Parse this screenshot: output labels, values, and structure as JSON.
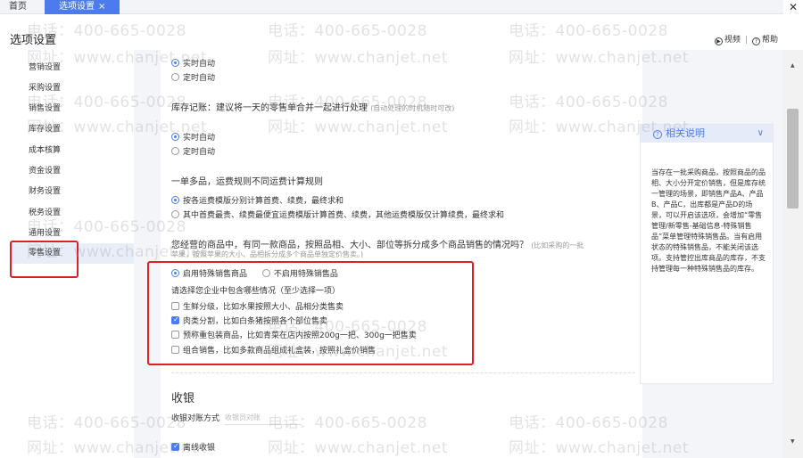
{
  "tabs": {
    "home": "首页",
    "active": "选项设置",
    "active_close": "×",
    "window_close": "✕"
  },
  "header": {
    "title": "选项设置",
    "video": "视频",
    "video_icon": "▶",
    "help": "帮助",
    "help_icon": "?",
    "separator": "|"
  },
  "sidebar": {
    "items": [
      "营销设置",
      "采购设置",
      "销售设置",
      "库存设置",
      "成本核算",
      "资金设置",
      "财务设置",
      "税务设置",
      "通用设置",
      "零售设置"
    ],
    "active_index": 9
  },
  "content": {
    "realtime_auto_1": "实时自动",
    "scheduled_auto_1": "定时自动",
    "stock_record_title": "库存记账：建议将一天的零售单合并一起进行处理",
    "stock_record_hint": "(自动处理的时机随时可改)",
    "realtime_auto_2": "实时自动",
    "scheduled_auto_2": "定时自动",
    "shipping_title": "一单多品，运费规则不同运费计算规则",
    "shipping_opt1": "按各运费模版分别计算首费、续费，最终求和",
    "shipping_opt2": "其中首费最贵、续费最便宜运费模版计算首费、续费，其他运费模版仅计算续费，最终求和",
    "split_title": "您经营的商品中，有同一款商品，按照品相、大小、部位等拆分成多个商品销售的情况吗？",
    "split_hint_1": "(比如采购的一批",
    "split_hint_2": "苹果，按照苹果的大小、品相拆分成多个商品单独定价售卖。)",
    "enable_special": "启用特殊销售商品",
    "disable_special": "不启用特殊销售品",
    "select_prompt": "请选择您企业中包含哪些情况（至少选择一项）",
    "options": [
      {
        "label": "生鲜分级，比如水果按照大小、品相分类售卖",
        "checked": false
      },
      {
        "label": "肉类分割，比如白条猪按照各个部位售卖",
        "checked": true
      },
      {
        "label": "预称重包装商品，比如青菜在店内按照200g一把、300g一把售卖",
        "checked": false
      },
      {
        "label": "组合销售，比如多款商品组成礼盒装，按照礼盒价销售",
        "checked": false
      }
    ],
    "checkout_title": "收银",
    "checkout_method_label": "收银对账方式",
    "checkout_method_value": "收银员对账",
    "offline_checkout": "离线收银"
  },
  "help_panel": {
    "title": "相关说明",
    "icon": "?",
    "chevron": "∨",
    "text": "当存在一批采购商品，按照商品的品相、大小分开定价销售，但是库存统一管理的场景，即销售产品A、产品B、产品C，出库都是产品D的场景，可以开启该选项，会增加“零售管理/新零售-基础信息-特殊销售品”菜单管理特殊销售品。当有启用状态的特殊销售品，不能关闭该选项。支持管控出库商品的库存，不支持管理每一种特殊销售品的库存。"
  },
  "watermark": {
    "phone": "电话：400-665-0028",
    "site": "网址：www.chanjet.net"
  },
  "colors": {
    "accent": "#4b7bec",
    "highlight_border": "#e02020"
  }
}
